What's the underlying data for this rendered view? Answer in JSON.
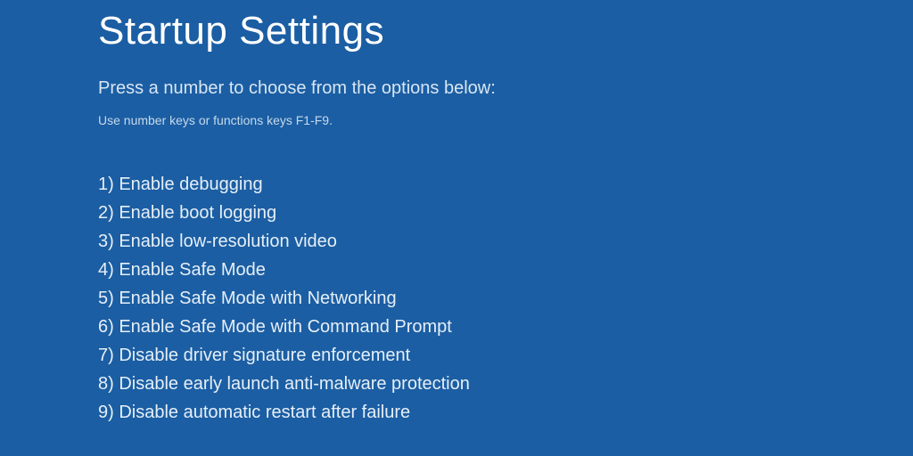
{
  "title": "Startup Settings",
  "instruction": "Press a number to choose from the options below:",
  "hint": "Use number keys or functions keys F1-F9.",
  "options": [
    "1) Enable debugging",
    "2) Enable boot logging",
    "3) Enable low-resolution video",
    "4) Enable Safe Mode",
    "5) Enable Safe Mode with Networking",
    "6) Enable Safe Mode with Command Prompt",
    "7) Disable driver signature enforcement",
    "8) Disable early launch anti-malware protection",
    "9) Disable automatic restart after failure"
  ]
}
